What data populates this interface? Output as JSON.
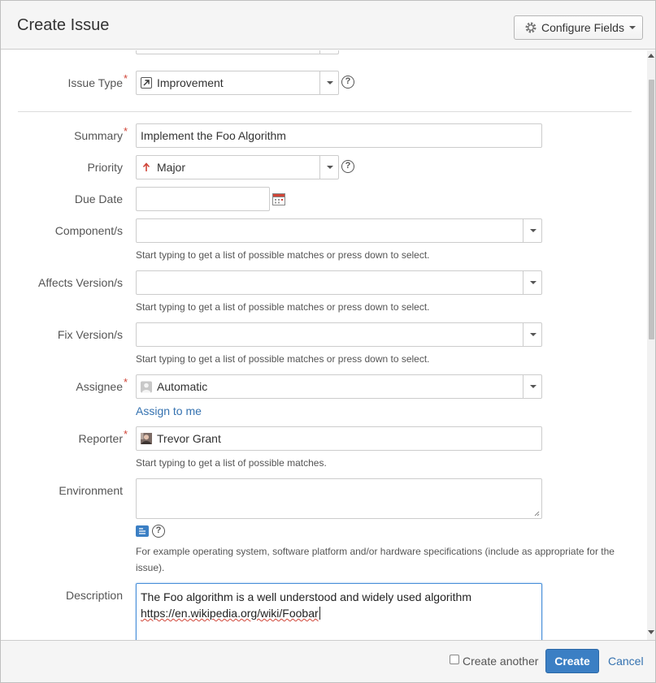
{
  "dialog": {
    "title": "Create Issue",
    "configure_fields_label": "Configure Fields"
  },
  "form": {
    "issue_type": {
      "label": "Issue Type",
      "value": "Improvement",
      "icon": "improvement-icon"
    },
    "summary": {
      "label": "Summary",
      "value": "Implement the Foo Algorithm"
    },
    "priority": {
      "label": "Priority",
      "value": "Major",
      "icon": "arrow-up-icon"
    },
    "due_date": {
      "label": "Due Date",
      "value": ""
    },
    "components": {
      "label": "Component/s",
      "value": "",
      "hint": "Start typing to get a list of possible matches or press down to select."
    },
    "affects_version": {
      "label": "Affects Version/s",
      "value": "",
      "hint": "Start typing to get a list of possible matches or press down to select."
    },
    "fix_version": {
      "label": "Fix Version/s",
      "value": "",
      "hint": "Start typing to get a list of possible matches or press down to select."
    },
    "assignee": {
      "label": "Assignee",
      "value": "Automatic",
      "assign_to_me": "Assign to me"
    },
    "reporter": {
      "label": "Reporter",
      "value": "Trevor Grant",
      "hint": "Start typing to get a list of possible matches."
    },
    "environment": {
      "label": "Environment",
      "value": "",
      "hint_line1": "For example operating system, software platform and/or hardware specifications (include as appropriate for the",
      "hint_line2": "issue)."
    },
    "description": {
      "label": "Description",
      "line1": "The Foo algorithm is a well understood and widely used algorithm",
      "line2": "https://en.wikipedia.org/wiki/Foobar"
    }
  },
  "footer": {
    "create_another_label": "Create another",
    "create_another_checked": false,
    "create_label": "Create",
    "cancel_label": "Cancel"
  },
  "colors": {
    "required": "#d04437",
    "link": "#3572b0",
    "primary_button": "#3b7fc4",
    "priority_major": "#d04437",
    "focus_border": "#4a90d9"
  }
}
